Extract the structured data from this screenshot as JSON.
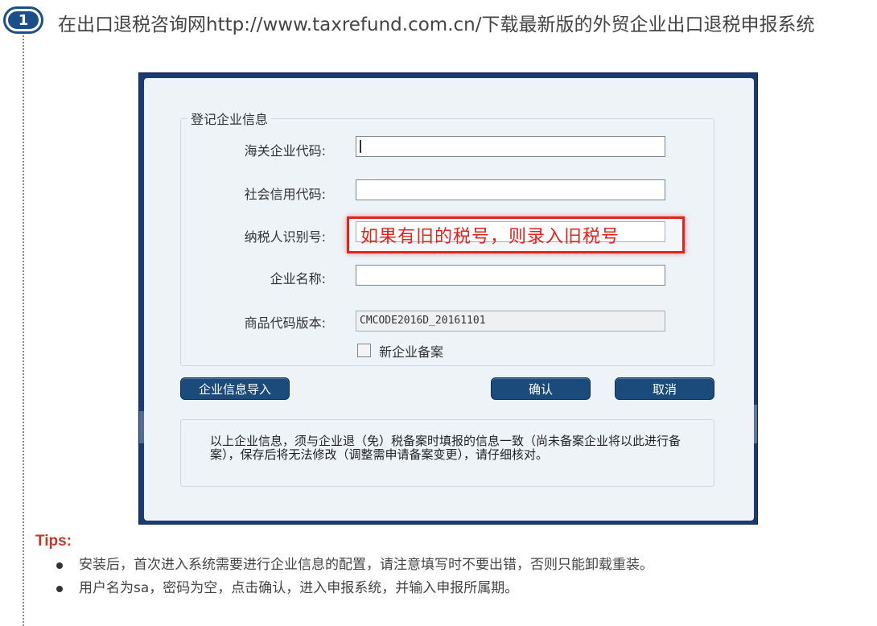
{
  "step": {
    "number": "1"
  },
  "heading": "在出口退税咨询网http://www.taxrefund.com.cn/下载最新版的外贸企业出口退税申报系统",
  "dialog": {
    "group_title": "登记企业信息",
    "fields": [
      {
        "label": "海关企业代码:",
        "value": ""
      },
      {
        "label": "社会信用代码:",
        "value": ""
      },
      {
        "label": "纳税人识别号:",
        "value": ""
      },
      {
        "label": "企业名称:",
        "value": ""
      },
      {
        "label": "商品代码版本:",
        "value": "CMCODE2016D_20161101"
      }
    ],
    "annotation": "如果有旧的税号，则录入旧税号",
    "checkbox_label": "新企业备案",
    "buttons": {
      "import": "企业信息导入",
      "confirm": "确认",
      "cancel": "取消"
    },
    "notice": "以上企业信息，须与企业退（免）税备案时填报的信息一致（尚未备案企业将以此进行备案），保存后将无法修改（调整需申请备案变更），请仔细核对。"
  },
  "tips": {
    "title": "Tips:",
    "items": [
      "安装后，首次进入系统需要进行企业信息的配置，请注意填写时不要出错，否则只能卸载重装。",
      "用户名为sa，密码为空，点击确认，进入申报系统，并输入申报所属期。"
    ]
  },
  "colors": {
    "accent": "#1d4e8c",
    "highlight": "#e0241b",
    "tips": "#c0392b"
  }
}
